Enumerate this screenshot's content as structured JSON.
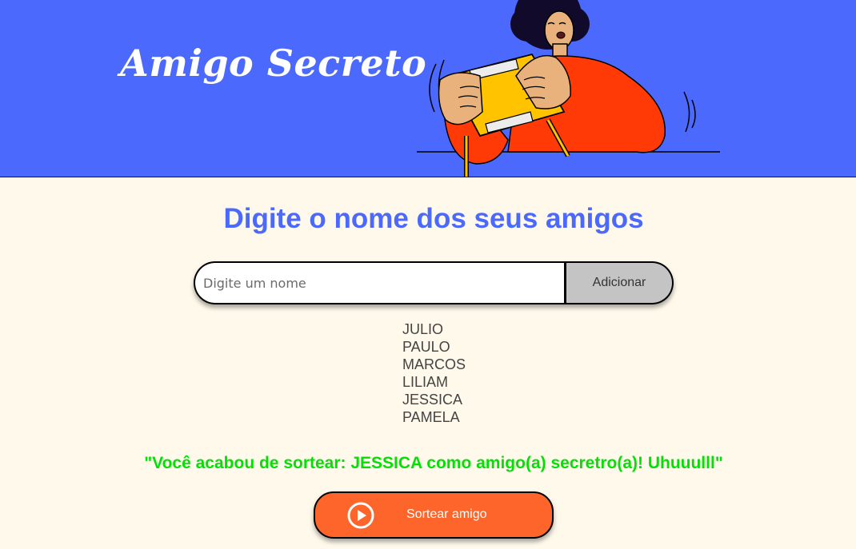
{
  "header": {
    "title": "Amigo Secreto",
    "illustration": "person-holding-gift-illustration",
    "background_color": "#4B69FD"
  },
  "main": {
    "heading": "Digite o nome dos seus amigos",
    "input": {
      "value": "",
      "placeholder": "Digite um nome"
    },
    "add_button_label": "Adicionar",
    "friends": [
      "JULIO",
      "PAULO",
      "MARCOS",
      "LILIAM",
      "JESSICA",
      "PAMELA"
    ],
    "result_text": "\"Você acabou de sortear: JESSICA como amigo(a) secretro(a)! Uhuuulll\"",
    "draw_button": {
      "label": "Sortear amigo",
      "icon": "play-circle-icon"
    }
  },
  "colors": {
    "page_background": "#FFF9EB",
    "heading": "#4B69FD",
    "result": "#05DF05",
    "draw_button": "#FE652B",
    "add_button": "#C4C4C4"
  }
}
